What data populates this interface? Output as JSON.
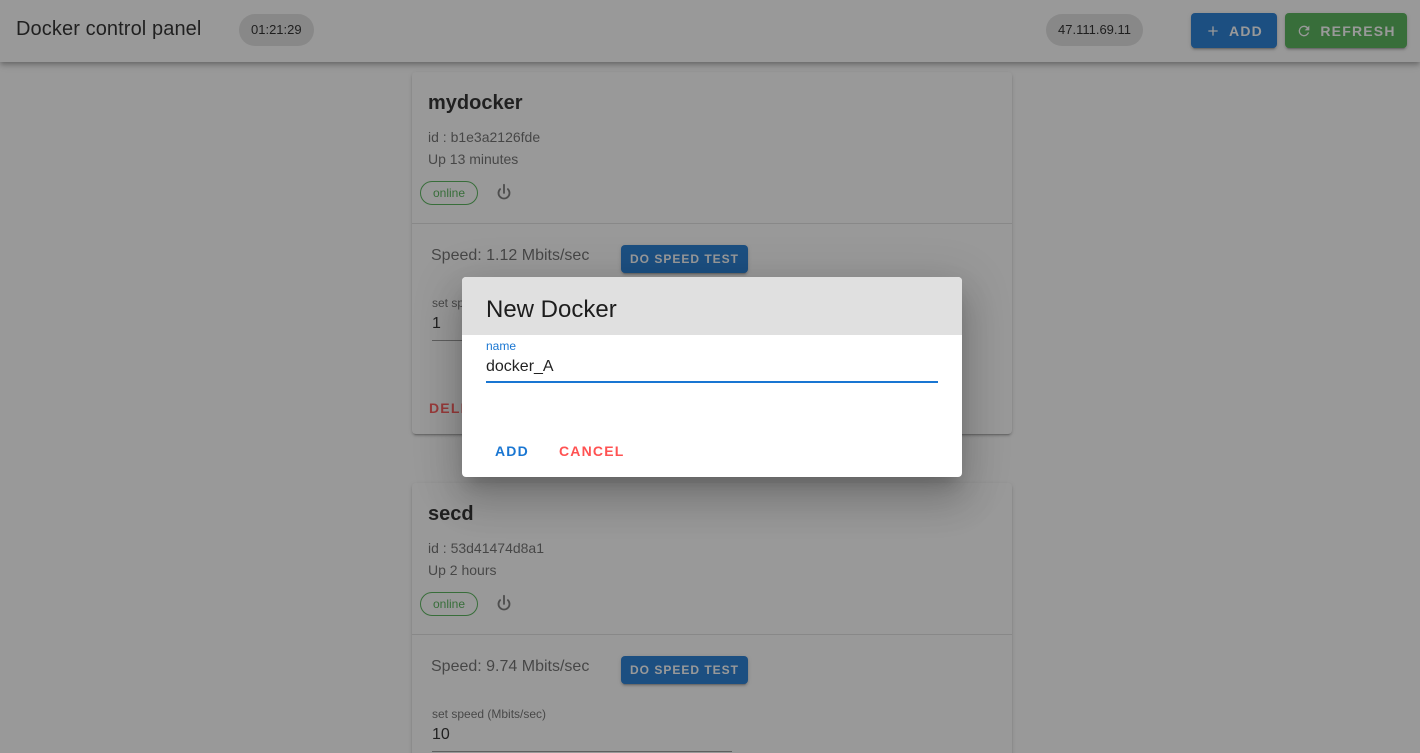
{
  "app": {
    "title": "Docker control panel",
    "clock": "01:21:29",
    "ip": "47.111.69.11",
    "add_label": "ADD",
    "refresh_label": "REFRESH"
  },
  "containers": [
    {
      "name": "mydocker",
      "id": "id : b1e3a2126fde",
      "uptime": "Up 13 minutes",
      "status": "online",
      "speed": "Speed: 1.12 Mbits/sec",
      "speed_test_label": "DO SPEED TEST",
      "set_speed_label": "set speed (Mbits/sec)",
      "set_speed_value": "1",
      "delete_label": "DELETE"
    },
    {
      "name": "secd",
      "id": "id : 53d41474d8a1",
      "uptime": "Up 2 hours",
      "status": "online",
      "speed": "Speed: 9.74 Mbits/sec",
      "speed_test_label": "DO SPEED TEST",
      "set_speed_label": "set speed (Mbits/sec)",
      "set_speed_value": "10"
    }
  ],
  "dialog": {
    "title": "New Docker",
    "field_label": "name",
    "field_value": "docker_A",
    "add_label": "ADD",
    "cancel_label": "CANCEL"
  },
  "colors": {
    "primary": "#1976d2",
    "success": "#4caf50",
    "error": "#ff5252",
    "chip_grey": "#e0e0e0"
  },
  "icons": {
    "add": "plus-icon",
    "refresh": "refresh-icon",
    "power": "power-icon"
  }
}
